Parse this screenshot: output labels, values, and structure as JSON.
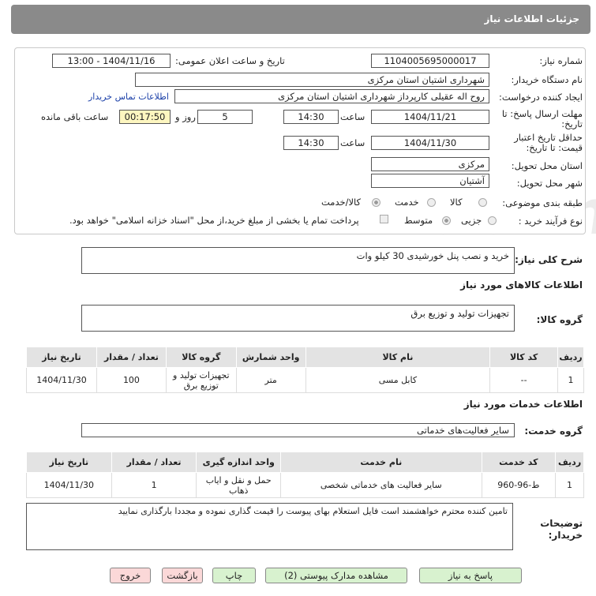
{
  "header": {
    "title": "جزئیات اطلاعات نیاز"
  },
  "form": {
    "need_number_label": "شماره نیاز:",
    "need_number": "1104005695000017",
    "announce_label": "تاریخ و ساعت اعلان عمومی:",
    "announce_value": "1404/11/16 - 13:00",
    "buyer_org_label": "نام دستگاه خریدار:",
    "buyer_org": "شهرداری اشتیان استان مرکزی",
    "creator_label": "ایجاد کننده درخواست:",
    "creator": "روح اله عقیلی کارپرداز شهرداری اشتیان استان مرکزی",
    "contact_link": "اطلاعات تماس خریدار",
    "deadline_label_1": "مهلت ارسال پاسخ: تا",
    "deadline_label_2": "تاریخ:",
    "deadline_date": "1404/11/21",
    "time_label": "ساعت",
    "deadline_time": "14:30",
    "days_value": "5",
    "days_label": "روز و",
    "remaining_time": "00:17:50",
    "remaining_label": "ساعت باقی مانده",
    "min_validity_label_1": "حداقل تاریخ اعتبار",
    "min_validity_label_2": "قیمت: تا تاریخ:",
    "validity_date": "1404/11/30",
    "validity_time": "14:30",
    "province_label": "استان محل تحویل:",
    "province": "مرکزی",
    "city_label": "شهر محل تحویل:",
    "city": "آشتیان",
    "category_label": "طبقه بندی موضوعی:",
    "category_options": [
      "کالا",
      "خدمت",
      "کالا/خدمت"
    ],
    "purchase_type_label": "نوع فرآیند خرید :",
    "purchase_options": [
      "جزیی",
      "متوسط"
    ],
    "payment_note": "پرداخت تمام یا بخشی از مبلغ خرید،از محل \"اسناد خزانه اسلامی\" خواهد بود."
  },
  "description": {
    "label": "شرح کلی نیاز:",
    "value": "خرید و نصب پنل خورشیدی 30 کیلو وات"
  },
  "goods": {
    "section_title": "اطلاعات کالاهای مورد نیاز",
    "group_label": "گروه کالا:",
    "group_value": "تجهیزات تولید و توزیع برق",
    "headers": [
      "ردیف",
      "کد کالا",
      "نام کالا",
      "واحد شمارش",
      "گروه کالا",
      "تعداد / مقدار",
      "تاریخ نیاز"
    ],
    "rows": [
      {
        "idx": "1",
        "code": "--",
        "name": "کابل مسی",
        "unit": "متر",
        "group": "تجهیزات تولید و توزیع برق",
        "qty": "100",
        "date": "1404/11/30"
      }
    ]
  },
  "services": {
    "section_title": "اطلاعات خدمات مورد نیاز",
    "group_label": "گروه خدمت:",
    "group_value": "سایر فعالیت‌های خدماتی",
    "headers": [
      "ردیف",
      "کد خدمت",
      "نام خدمت",
      "واحد اندازه گیری",
      "تعداد / مقدار",
      "تاریخ نیاز"
    ],
    "rows": [
      {
        "idx": "1",
        "code": "ط-96-960",
        "name": "سایر فعالیت های خدماتی شخصی",
        "unit": "حمل و نقل و ایاب ذهاب",
        "qty": "1",
        "date": "1404/11/30"
      }
    ]
  },
  "notes": {
    "label_1": "توضیحات",
    "label_2": "خریدار:",
    "value": "تامین کننده محترم خواهشمند است فایل استعلام بهای  پیوست را قیمت گذاری نموده و مجددا بارگذاری نمایید"
  },
  "buttons": {
    "reply": "پاسخ به نیاز",
    "attachments": "مشاهده مدارک پیوستی (2)",
    "print": "چاپ",
    "back": "بازگشت",
    "exit": "خروج"
  },
  "watermark": "AriaTender.neT",
  "colors": {
    "header_bg": "#8a8a8a",
    "green_btn": "#d8f2cf",
    "red_btn": "#fbd8d8",
    "yellow_box": "#fdf6c0",
    "link": "#1a3fa8"
  }
}
